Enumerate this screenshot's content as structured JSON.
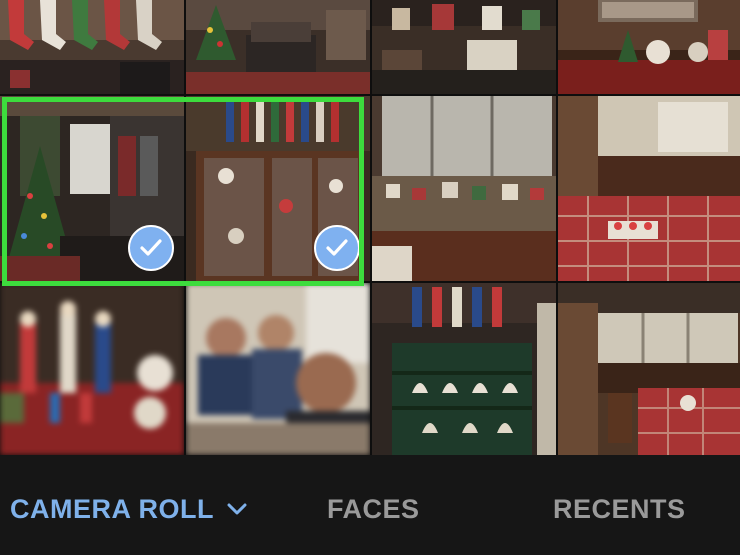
{
  "photo_grid": {
    "selected_count": 2,
    "accent_color": "#3ddc3d",
    "check_color": "#7fb1f0",
    "photos": [
      {
        "subject": "stockings on mantel",
        "selected": false
      },
      {
        "subject": "living room with tree",
        "selected": false
      },
      {
        "subject": "christmas village shelf",
        "selected": false
      },
      {
        "subject": "dining room buffet",
        "selected": false
      },
      {
        "subject": "room with christmas tree",
        "selected": true
      },
      {
        "subject": "curio cabinet with nutcrackers",
        "selected": true
      },
      {
        "subject": "window with christmas village",
        "selected": false
      },
      {
        "subject": "dining table with plaid cloth",
        "selected": false
      },
      {
        "subject": "nutcracker figurines",
        "selected": false
      },
      {
        "subject": "people selfie",
        "selected": false
      },
      {
        "subject": "bell display shelf",
        "selected": false
      },
      {
        "subject": "dining room table",
        "selected": false
      }
    ]
  },
  "tabbar": {
    "camera_roll_label": "CAMERA ROLL",
    "faces_label": "FACES",
    "recents_label": "RECENTS",
    "active_tab": "camera-roll",
    "active_color": "#7fb1ea",
    "inactive_color": "#9a9a9a"
  }
}
